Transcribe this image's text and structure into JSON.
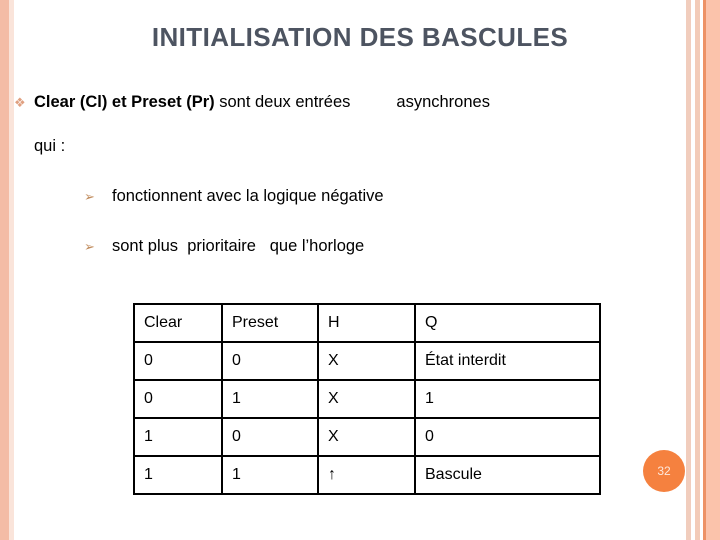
{
  "slide": {
    "title": "INITIALISATION DES BASCULES",
    "page_number": "32"
  },
  "colors": {
    "title": "#4d5461",
    "accent_stripe": "#f4bca6",
    "accent_stripe_dark": "#ed9266",
    "badge_bg": "#f5813f",
    "badge_text": "#fde8dc",
    "bullet_level1": "#e0a080",
    "bullet_level2": "#c08b5c",
    "table_border": "#000000",
    "body_text": "#000000"
  },
  "bullets": {
    "level1": {
      "marker": "diamond-floret-bullet-icon",
      "marker_glyph": "❖",
      "bold_part": "Clear (Cl) et Preset (Pr)",
      "rest_part": "sont deux entrées",
      "trailing_part": "asynchrones",
      "continuation": "qui  :"
    },
    "level2": {
      "marker": "arrow-bullet-icon",
      "marker_glyph": "➢",
      "items": [
        "fonctionnent avec la logique négative",
        "sont plus  prioritaire   que l’horloge"
      ]
    }
  },
  "table": {
    "headers": [
      "Clear",
      "Preset",
      "H",
      "Q"
    ],
    "rows": [
      [
        "0",
        "0",
        "X",
        "État interdit"
      ],
      [
        "0",
        "1",
        "X",
        "1"
      ],
      [
        "1",
        "0",
        "X",
        "0"
      ],
      [
        "1",
        "1",
        "↑",
        "Bascule"
      ]
    ]
  }
}
